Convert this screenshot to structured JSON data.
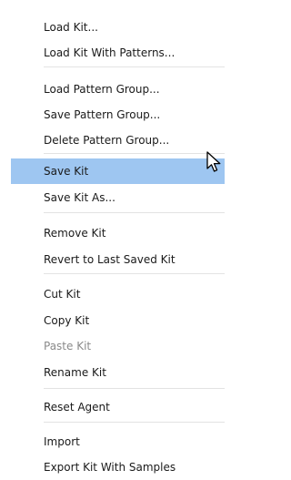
{
  "context_menu": {
    "items": [
      {
        "label": "Load Kit..."
      },
      {
        "label": "Load Kit With Patterns..."
      },
      {
        "label": "Load Pattern Group..."
      },
      {
        "label": "Save Pattern Group..."
      },
      {
        "label": "Delete Pattern Group..."
      },
      {
        "label": "Save Kit",
        "state": "highlighted"
      },
      {
        "label": "Save Kit As..."
      },
      {
        "label": "Remove Kit"
      },
      {
        "label": "Revert to Last Saved Kit"
      },
      {
        "label": "Cut Kit"
      },
      {
        "label": "Copy Kit"
      },
      {
        "label": "Paste Kit",
        "state": "disabled"
      },
      {
        "label": "Rename Kit"
      },
      {
        "label": "Reset Agent"
      },
      {
        "label": "Import"
      },
      {
        "label": "Export Kit With Samples"
      }
    ],
    "highlight_color": "#9ec6f1"
  },
  "cursor": {
    "icon": "arrow-pointer-icon"
  }
}
